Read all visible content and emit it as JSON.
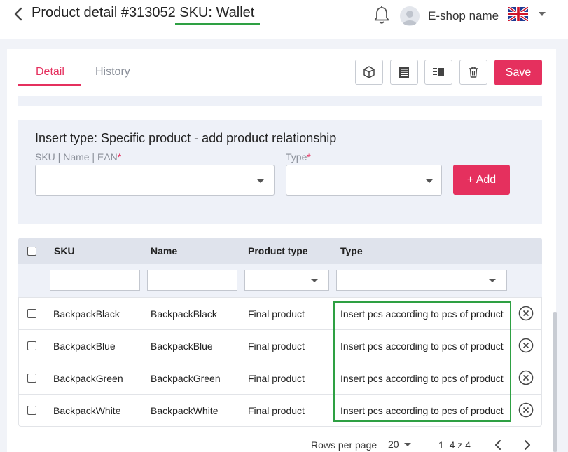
{
  "header": {
    "title": "Product detail #313052 SKU: Wallet",
    "shop_name": "E-shop name",
    "icons": {
      "back": "chevron-left-icon",
      "notifications": "bell-icon",
      "avatar": "user-avatar-icon",
      "language": "uk-flag-icon",
      "menu": "chevron-down-icon"
    }
  },
  "tabs": [
    {
      "label": "Detail",
      "active": true
    },
    {
      "label": "History",
      "active": false
    }
  ],
  "toolbar": {
    "icons": [
      "package-icon",
      "barcode-list-icon",
      "columns-icon",
      "trash-icon"
    ],
    "save_label": "Save"
  },
  "insert": {
    "title": "Insert type: Specific product - add product relationship",
    "sku_label": "SKU | Name | EAN",
    "type_label": "Type",
    "required_mark": "*",
    "sku_value": "",
    "type_value": "",
    "add_label": "+ Add"
  },
  "table": {
    "columns": [
      "SKU",
      "Name",
      "Product type",
      "Type"
    ],
    "rows": [
      {
        "sku": "BackpackBlack",
        "name": "BackpackBlack",
        "product_type": "Final product",
        "type": "Insert pcs according to pcs of product"
      },
      {
        "sku": "BackpackBlue",
        "name": "BackpackBlue",
        "product_type": "Final product",
        "type": "Insert pcs according to pcs of product"
      },
      {
        "sku": "BackpackGreen",
        "name": "BackpackGreen",
        "product_type": "Final product",
        "type": "Insert pcs according to pcs of product"
      },
      {
        "sku": "BackpackWhite",
        "name": "BackpackWhite",
        "product_type": "Final product",
        "type": "Insert pcs according to pcs of product"
      }
    ]
  },
  "pagination": {
    "rows_per_page_label": "Rows per page",
    "rows_per_page": "20",
    "range": "1–4 z 4"
  },
  "colors": {
    "accent": "#e5305e",
    "highlight": "#2ea043",
    "header_bg": "#dfe3ec",
    "panel_bg": "#eef1f8"
  }
}
